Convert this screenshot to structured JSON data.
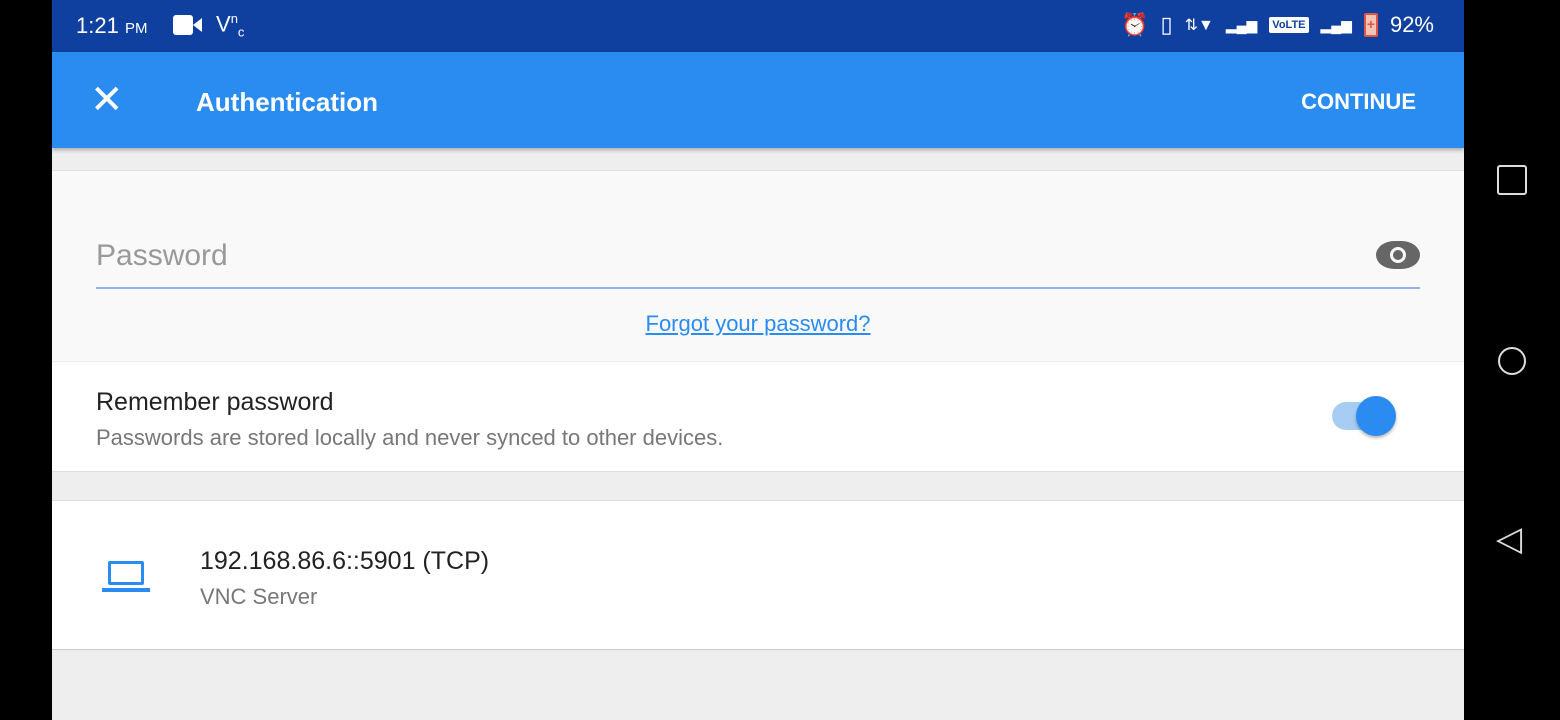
{
  "status_bar": {
    "time": "1:21",
    "ampm": "PM",
    "vnc_icon": "V²c",
    "volte": "VoLTE",
    "battery": "92%"
  },
  "app_bar": {
    "title": "Authentication",
    "close": "✕",
    "continue_label": "CONTINUE"
  },
  "password": {
    "placeholder": "Password",
    "forgot_link": "Forgot your password?"
  },
  "remember": {
    "title": "Remember password",
    "subtitle": "Passwords are stored locally and never synced to other devices.",
    "enabled": true
  },
  "server": {
    "address": "192.168.86.6::5901 (TCP)",
    "type": "VNC Server"
  },
  "nav": {
    "recents": "",
    "home": "",
    "back": "◁"
  }
}
